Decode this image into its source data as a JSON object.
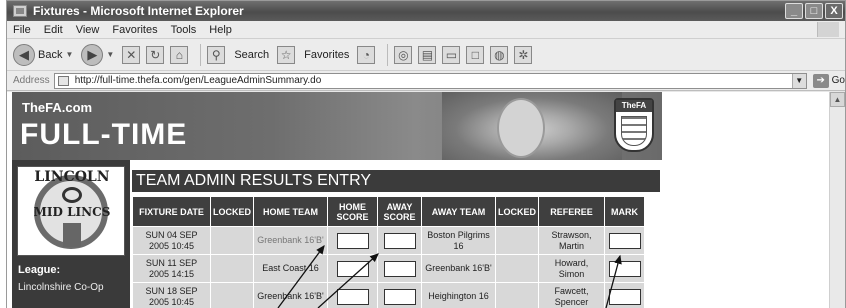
{
  "window": {
    "title": "Fixtures - Microsoft Internet Explorer",
    "controls": [
      "_",
      "□",
      "X"
    ]
  },
  "menu": [
    "File",
    "Edit",
    "View",
    "Favorites",
    "Tools",
    "Help"
  ],
  "toolbar": {
    "back_label": "Back",
    "search_label": "Search",
    "favorites_label": "Favorites"
  },
  "address": {
    "label": "Address",
    "url": "http://full-time.thefa.com/gen/LeagueAdminSummary.do",
    "go_label": "Go"
  },
  "banner": {
    "brand_small": "TheFA.com",
    "brand_big": "FULL-TIME",
    "crest_label": "TheFA"
  },
  "league_logo": {
    "top_text": "LINCOLN",
    "mid_text": "MID LINCS"
  },
  "sidebar": {
    "league_label": "League:",
    "league_value": "Lincolnshire Co-Op"
  },
  "page": {
    "heading": "TEAM ADMIN RESULTS ENTRY"
  },
  "table": {
    "headers": {
      "date": "FIXTURE DATE",
      "locked": "LOCKED",
      "home_team": "HOME TEAM",
      "home_score": "HOME SCORE",
      "away_score": "AWAY SCORE",
      "away_team": "AWAY TEAM",
      "locked2": "LOCKED",
      "referee": "REFEREE",
      "mark": "MARK"
    },
    "rows": [
      {
        "date": "SUN 04 SEP 2005 10:45",
        "home_team": "Greenbank 16'B'",
        "away_team": "Boston Pilgrims 16",
        "referee": "Strawson, Martin"
      },
      {
        "date": "SUN 11 SEP 2005 14:15",
        "home_team": "East Coast 16",
        "away_team": "Greenbank 16'B'",
        "referee": "Howard, Simon"
      },
      {
        "date": "SUN 18 SEP 2005 10:45",
        "home_team": "Greenbank 16'B'",
        "away_team": "Heighington 16",
        "referee": "Fawcett, Spencer"
      }
    ]
  },
  "colors": {
    "titlebar": "#5a5a5a",
    "header_cell": "#3f3f3f",
    "data_cell": "#d8d8d8",
    "sidebar": "#3a3a3a"
  }
}
